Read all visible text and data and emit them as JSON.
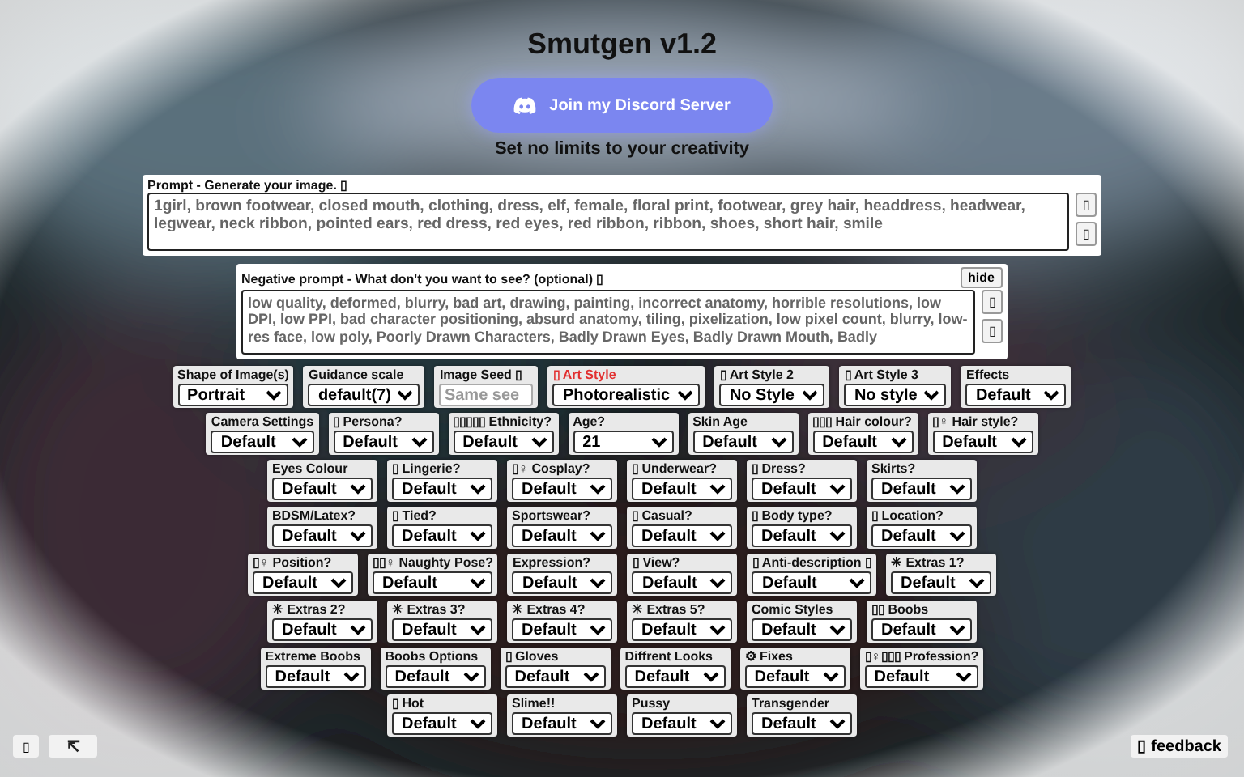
{
  "title": "Smutgen v1.2",
  "discord_button": {
    "label": "Join my Discord Server"
  },
  "tagline": "Set no limits to your creativity",
  "prompt": {
    "label": "Prompt - Generate your image. ▯",
    "value": "1girl, brown footwear, closed mouth, clothing, dress, elf, female, floral print, footwear, grey hair, headdress, headwear, legwear, neck ribbon, pointed ears, red dress, red eyes, red ribbon, ribbon, shoes, short hair, smile",
    "side_buttons": [
      "▯",
      "▯"
    ]
  },
  "negative_prompt": {
    "label": "Negative prompt - What don't you want to see? (optional) ▯",
    "hide_button": "hide",
    "value": "low quality, deformed, blurry, bad art, drawing, painting, incorrect anatomy, horrible resolutions, low DPI, low PPI, bad character positioning, absurd anatomy, tiling, pixelization, low pixel count, blurry, low-res face, low poly, Poorly Drawn Characters, Badly Drawn Eyes, Badly Drawn Mouth, Badly",
    "side_buttons": [
      "▯",
      "▯"
    ]
  },
  "option_rows": [
    [
      {
        "label": "Shape of Image(s)",
        "kind": "select",
        "value": "Portrait",
        "highlighted": false
      },
      {
        "label": "Guidance scale",
        "kind": "select",
        "value": "default(7)",
        "highlighted": false
      },
      {
        "label": "Image Seed ▯",
        "kind": "input",
        "placeholder": "Same see",
        "highlighted": false
      },
      {
        "label": "▯ Art Style",
        "kind": "select",
        "value": "Photorealistic",
        "highlighted": true
      },
      {
        "label": "▯ Art Style 2",
        "kind": "select",
        "value": "No Style",
        "highlighted": false
      },
      {
        "label": "▯ Art Style 3",
        "kind": "select",
        "value": "No style",
        "highlighted": false
      },
      {
        "label": "Effects",
        "kind": "select",
        "value": "Default",
        "highlighted": false
      }
    ],
    [
      {
        "label": "Camera Settings",
        "kind": "select",
        "value": "Default",
        "highlighted": false
      },
      {
        "label": "▯ Persona?",
        "kind": "select",
        "value": "Default",
        "highlighted": false
      },
      {
        "label": "▯▯▯▯▯ Ethnicity?",
        "kind": "select",
        "value": "Default",
        "highlighted": false
      },
      {
        "label": "Age?",
        "kind": "select",
        "value": "21",
        "highlighted": false
      },
      {
        "label": "Skin Age",
        "kind": "select",
        "value": "Default",
        "highlighted": false
      },
      {
        "label": "▯▯▯ Hair colour?",
        "kind": "select",
        "value": "Default",
        "highlighted": false
      },
      {
        "label": "▯♀ Hair style?",
        "kind": "select",
        "value": "Default",
        "highlighted": false
      }
    ],
    [
      {
        "label": "Eyes Colour",
        "kind": "select",
        "value": "Default",
        "highlighted": false
      },
      {
        "label": "▯ Lingerie?",
        "kind": "select",
        "value": "Default",
        "highlighted": false
      },
      {
        "label": "▯♀ Cosplay?",
        "kind": "select",
        "value": "Default",
        "highlighted": false
      },
      {
        "label": "▯ Underwear?",
        "kind": "select",
        "value": "Default",
        "highlighted": false
      },
      {
        "label": "▯ Dress?",
        "kind": "select",
        "value": "Default",
        "highlighted": false
      },
      {
        "label": "Skirts?",
        "kind": "select",
        "value": "Default",
        "highlighted": false
      }
    ],
    [
      {
        "label": "BDSM/Latex?",
        "kind": "select",
        "value": "Default",
        "highlighted": false
      },
      {
        "label": "▯ Tied?",
        "kind": "select",
        "value": "Default",
        "highlighted": false
      },
      {
        "label": "Sportswear?",
        "kind": "select",
        "value": "Default",
        "highlighted": false
      },
      {
        "label": "▯ Casual?",
        "kind": "select",
        "value": "Default",
        "highlighted": false
      },
      {
        "label": "▯ Body type?",
        "kind": "select",
        "value": "Default",
        "highlighted": false
      },
      {
        "label": "▯ Location?",
        "kind": "select",
        "value": "Default",
        "highlighted": false
      }
    ],
    [
      {
        "label": "▯♀ Position?",
        "kind": "select",
        "value": "Default",
        "highlighted": false
      },
      {
        "label": "▯▯♀ Naughty Pose?",
        "kind": "select",
        "value": "Default",
        "highlighted": false
      },
      {
        "label": "Expression?",
        "kind": "select",
        "value": "Default",
        "highlighted": false
      },
      {
        "label": "▯ View?",
        "kind": "select",
        "value": "Default",
        "highlighted": false
      },
      {
        "label": "▯ Anti-description ▯",
        "kind": "select",
        "value": "Default",
        "highlighted": false
      },
      {
        "label": "✳ Extras 1?",
        "kind": "select",
        "value": "Default",
        "highlighted": false
      }
    ],
    [
      {
        "label": "✳ Extras 2?",
        "kind": "select",
        "value": "Default",
        "highlighted": false
      },
      {
        "label": "✳ Extras 3?",
        "kind": "select",
        "value": "Default",
        "highlighted": false
      },
      {
        "label": "✳ Extras 4?",
        "kind": "select",
        "value": "Default",
        "highlighted": false
      },
      {
        "label": "✳ Extras 5?",
        "kind": "select",
        "value": "Default",
        "highlighted": false
      },
      {
        "label": "Comic Styles",
        "kind": "select",
        "value": "Default",
        "highlighted": false
      },
      {
        "label": "▯▯ Boobs",
        "kind": "select",
        "value": "Default",
        "highlighted": false
      }
    ],
    [
      {
        "label": "Extreme Boobs",
        "kind": "select",
        "value": "Default",
        "highlighted": false
      },
      {
        "label": "Boobs Options",
        "kind": "select",
        "value": "Default",
        "highlighted": false
      },
      {
        "label": "▯ Gloves",
        "kind": "select",
        "value": "Default",
        "highlighted": false
      },
      {
        "label": "Diffrent Looks",
        "kind": "select",
        "value": "Default",
        "highlighted": false
      },
      {
        "label": "⚙ Fixes",
        "kind": "select",
        "value": "Default",
        "highlighted": false
      },
      {
        "label": "▯♀▯▯▯ Profession?",
        "kind": "select",
        "value": "Default",
        "highlighted": false
      }
    ],
    [
      {
        "label": "▯ Hot",
        "kind": "select",
        "value": "Default",
        "highlighted": false
      },
      {
        "label": "Slime!!",
        "kind": "select",
        "value": "Default",
        "highlighted": false
      },
      {
        "label": "Pussy",
        "kind": "select",
        "value": "Default",
        "highlighted": false
      },
      {
        "label": "Transgender",
        "kind": "select",
        "value": "Default",
        "highlighted": false
      }
    ]
  ],
  "corner_buttons": [
    {
      "kind": "text",
      "label": "▯"
    },
    {
      "kind": "icon"
    }
  ],
  "feedback_button": "▯ feedback"
}
